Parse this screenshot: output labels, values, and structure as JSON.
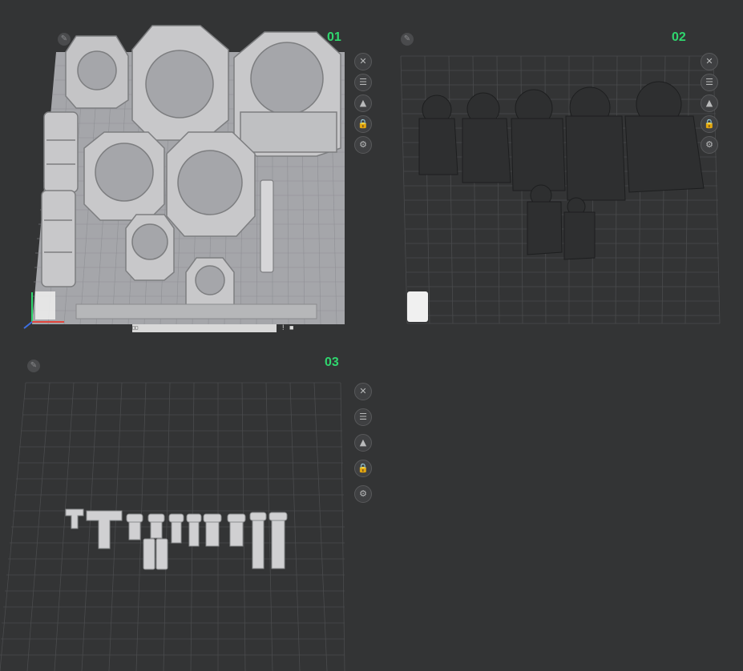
{
  "plates": [
    {
      "title": "01"
    },
    {
      "title": "02"
    },
    {
      "title": "03"
    }
  ],
  "side_buttons": [
    "close-icon",
    "list-icon",
    "auto-orient-icon",
    "lock-icon",
    "settings-icon"
  ],
  "status_bar": {
    "text": "",
    "icons": [
      "printer-icon",
      "warning-icon",
      "bottle-icon"
    ]
  },
  "colors": {
    "background": "#333435",
    "plate_title": "#2fd66e",
    "grey_parts": "#bdbdbd",
    "dark_parts": "#2e2f30"
  }
}
